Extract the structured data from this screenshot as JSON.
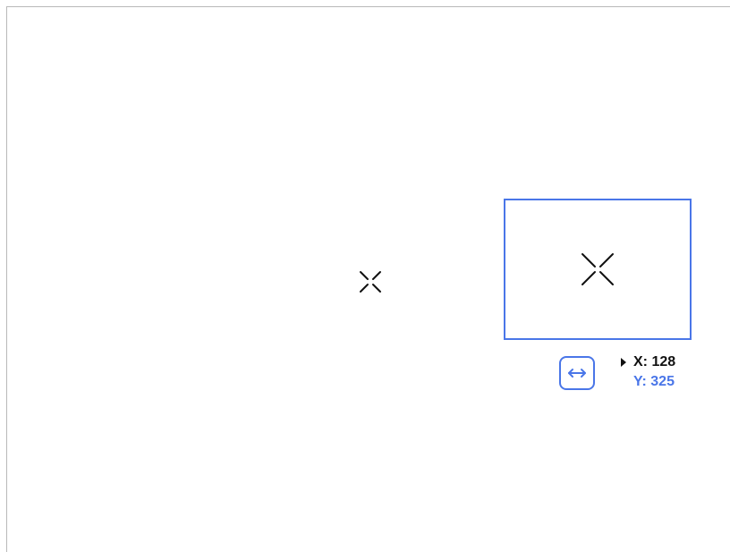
{
  "colors": {
    "accent": "#4a76e8",
    "text": "#111111",
    "border": "#b8b8b8"
  },
  "icons": {
    "center": "crosshair-icon",
    "zoom": "crosshair-icon",
    "swap": "swap-horizontal-icon",
    "caret": "triangle-right-icon"
  },
  "coordinates": {
    "x_label": "X:",
    "x_value": "128",
    "y_label": "Y:",
    "y_value": "325"
  }
}
